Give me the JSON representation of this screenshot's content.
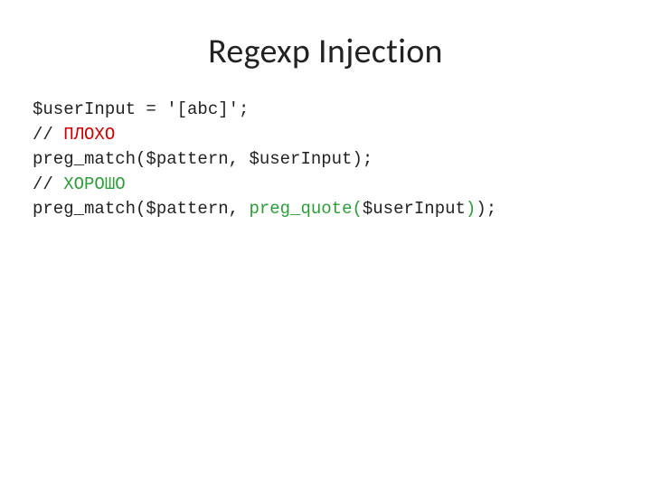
{
  "title": "Regexp Injection",
  "code": {
    "l1": "$userInput = '[abc]';",
    "l2a": "// ",
    "l2b": "ПЛОХО",
    "l3": "preg_match($pattern, $userInput);",
    "l4a": "// ",
    "l4b": "ХОРОШО",
    "l5a": "preg_match($pattern, ",
    "l5b": "preg_quote(",
    "l5c": "$userInput",
    "l5d": ")",
    "l5e": ");"
  }
}
